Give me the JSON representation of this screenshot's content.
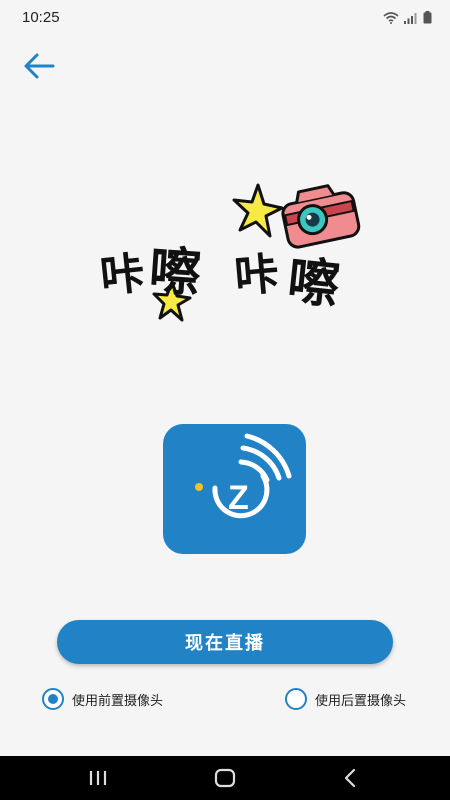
{
  "status_bar": {
    "time": "10:25"
  },
  "banner": {
    "text": "咔嚓咔嚓"
  },
  "main": {
    "live_button_label": "现在直播"
  },
  "camera_options": {
    "front": {
      "label": "使用前置摄像头",
      "selected": true
    },
    "rear": {
      "label": "使用后置摄像头",
      "selected": false
    }
  },
  "colors": {
    "accent": "#2183c6",
    "background": "#f5f5f5",
    "nav_bar": "#000000"
  },
  "icons": [
    "wifi-icon",
    "signal-icon",
    "battery-icon",
    "back-arrow-icon",
    "camera-icon",
    "sparkle-icon",
    "app-logo-icon",
    "recent-apps-icon",
    "home-icon",
    "back-icon"
  ]
}
